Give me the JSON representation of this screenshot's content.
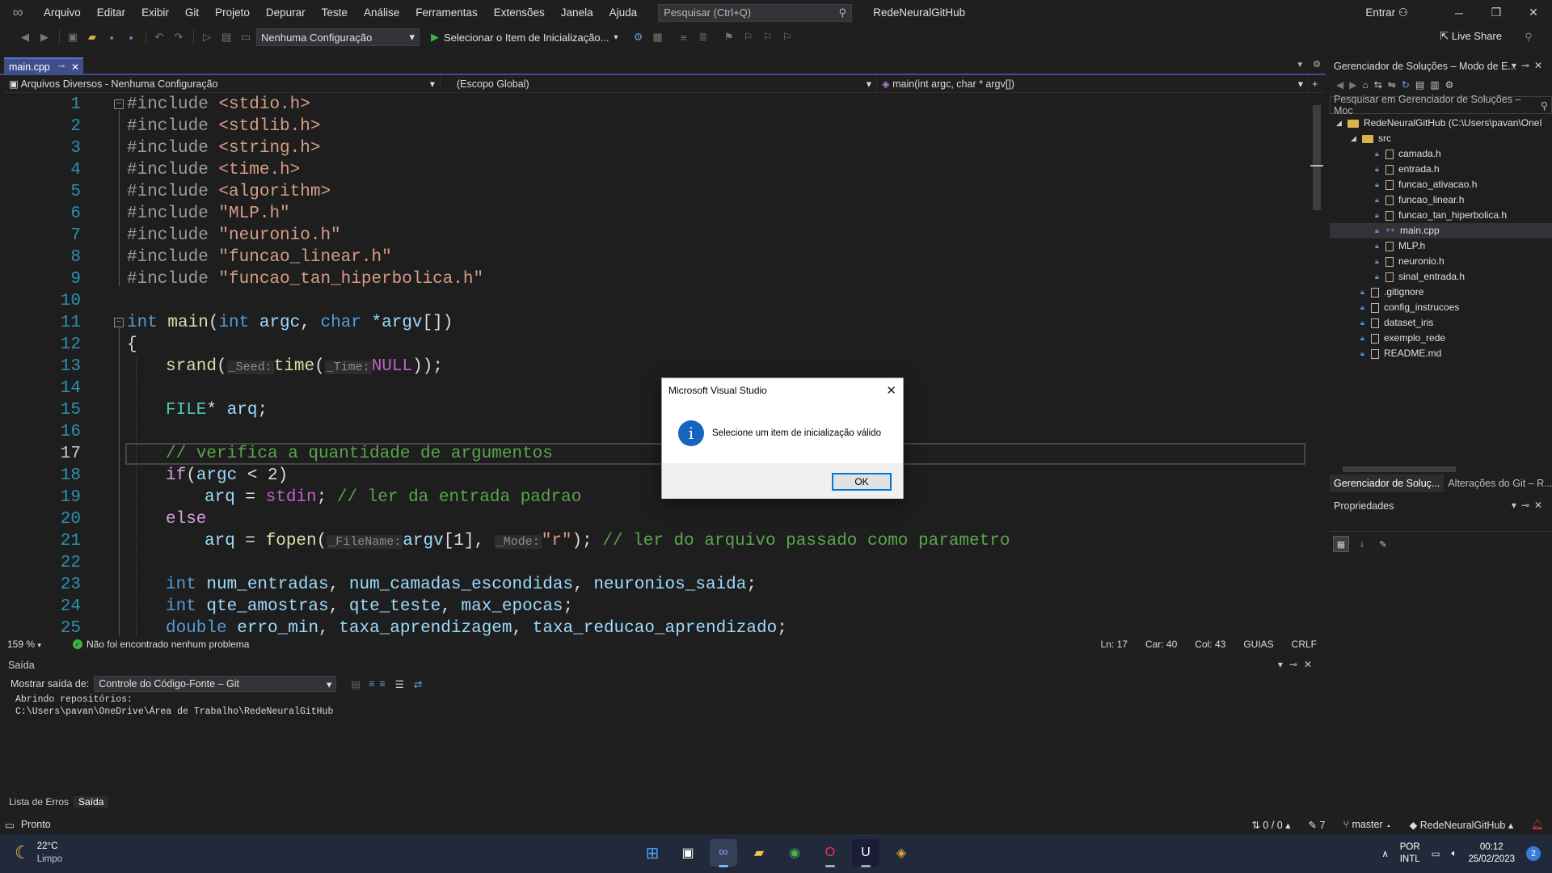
{
  "menu": {
    "items": [
      "Arquivo",
      "Editar",
      "Exibir",
      "Git",
      "Projeto",
      "Depurar",
      "Teste",
      "Análise",
      "Ferramentas",
      "Extensões",
      "Janela",
      "Ajuda"
    ],
    "search_placeholder": "Pesquisar (Ctrl+Q)",
    "solution_name": "RedeNeuralGitHub",
    "signin": "Entrar"
  },
  "toolbar": {
    "config": "Nenhuma Configuração",
    "run_label": "Selecionar o Item de Inicialização...",
    "live_share": "Live Share"
  },
  "editor": {
    "tab_name": "main.cpp",
    "nav_project": "Arquivos Diversos - Nenhuma Configuração",
    "nav_scope": "(Escopo Global)",
    "nav_member": "main(int argc, char * argv[])",
    "line_numbers": [
      "1",
      "2",
      "3",
      "4",
      "5",
      "6",
      "7",
      "8",
      "9",
      "10",
      "11",
      "12",
      "13",
      "14",
      "15",
      "16",
      "17",
      "18",
      "19",
      "20",
      "21",
      "22",
      "23",
      "24",
      "25"
    ],
    "lines": {
      "l1_pp": "#include",
      "l1_rest": " <stdio.h>",
      "l2_pp": "#include",
      "l2_rest": " <stdlib.h>",
      "l3_pp": "#include",
      "l3_rest": " <string.h>",
      "l4_pp": "#include",
      "l4_rest": " <time.h>",
      "l5_pp": "#include",
      "l5_rest": " <algorithm>",
      "l6_pp": "#include",
      "l6_rest": " \"MLP.h\"",
      "l7_pp": "#include",
      "l7_rest": " \"neuronio.h\"",
      "l8_pp": "#include",
      "l8_rest": " \"funcao_linear.h\"",
      "l9_pp": "#include",
      "l9_rest": " \"funcao_tan_hiperbolica.h\"",
      "l11_int": "int",
      "l11_main": " main",
      "l11_p1": "(",
      "l11_int2": "int",
      "l11_argc": " argc",
      "l11_c": ", ",
      "l11_char": "char",
      "l11_argv": " *argv",
      "l11_end": "[])",
      "l12": "{",
      "l13_srand": "srand",
      "l13_p": "(",
      "l13_hint1": "_Seed:",
      "l13_time": "time",
      "l13_p2": "(",
      "l13_hint2": "_Time:",
      "l13_null": "NULL",
      "l13_end": "));",
      "l15_type": "FILE",
      "l15_rest": "* ",
      "l15_var": "arq",
      "l15_end": ";",
      "l17": "// verifica a quantidade de argumentos",
      "l18_if": "if",
      "l18_p": "(",
      "l18_argc": "argc",
      "l18_rest": " < 2)",
      "l19_arq": "arq",
      "l19_eq": " = ",
      "l19_stdin": "stdin",
      "l19_semi": "; ",
      "l19_cmt": "// ler da entrada padrao",
      "l20": "else",
      "l21_arq": "arq",
      "l21_eq": " = ",
      "l21_fopen": "fopen",
      "l21_p": "(",
      "l21_hint1": "_FileName:",
      "l21_argv": "argv",
      "l21_idx": "[1], ",
      "l21_hint2": "_Mode:",
      "l21_str": "\"r\"",
      "l21_semi": "); ",
      "l21_cmt": "// ler do arquivo passado como parametro",
      "l23_int": "int",
      "l23_vars": " num_entradas",
      "l23_c1": ", ",
      "l23_v2": "num_camadas_escondidas",
      "l23_c2": ", ",
      "l23_v3": "neuronios_saida",
      "l23_end": ";",
      "l24_int": "int",
      "l24_v1": " qte_amostras",
      "l24_c1": ", ",
      "l24_v2": "qte_teste",
      "l24_c2": ", ",
      "l24_v3": "max_epocas",
      "l24_end": ";",
      "l25_dbl": "double",
      "l25_v1": " erro_min",
      "l25_c1": ", ",
      "l25_v2": "taxa_aprendizagem",
      "l25_c2": ", ",
      "l25_v3": "taxa_reducao_aprendizado",
      "l25_end": ";"
    },
    "zoom": "159 %",
    "issues": "Não foi encontrado nenhum problema",
    "ln": "Ln: 17",
    "car": "Car: 40",
    "col": "Col: 43",
    "guides": "GUIAS",
    "eol": "CRLF"
  },
  "output": {
    "title": "Saída",
    "show_from_label": "Mostrar saída de:",
    "source": "Controle do Código-Fonte – Git",
    "text_line1": "Abrindo repositórios:",
    "text_line2": "C:\\Users\\pavan\\OneDrive\\Área de Trabalho\\RedeNeuralGitHub",
    "tabs": [
      "Lista de Erros",
      "Saída"
    ]
  },
  "solution_explorer": {
    "title": "Gerenciador de Soluções – Modo de E...",
    "search_placeholder": "Pesquisar em Gerenciador de Soluções – Moc",
    "root": "RedeNeuralGitHub (C:\\Users\\pavan\\OneI",
    "folder": "src",
    "src_files": [
      "camada.h",
      "entrada.h",
      "funcao_ativacao.h",
      "funcao_linear.h",
      "funcao_tan_hiperbolica.h",
      "main.cpp",
      "MLP.h",
      "neuronio.h",
      "sinal_entrada.h"
    ],
    "root_files": [
      ".gitignore",
      "config_instrucoes",
      "dataset_iris",
      "exemplo_rede",
      "README.md"
    ],
    "tabs": [
      "Gerenciador de Soluç...",
      "Alterações do Git – R..."
    ]
  },
  "properties": {
    "title": "Propriedades"
  },
  "statusbar": {
    "ready": "Pronto",
    "commits": "0 / 0",
    "changes": "7",
    "branch": "master",
    "repo": "RedeNeuralGitHub"
  },
  "dialog": {
    "title": "Microsoft Visual Studio",
    "message": "Selecione um item de inicialização válido",
    "ok": "OK"
  },
  "taskbar": {
    "temp": "22°C",
    "weather": "Limpo",
    "lang1": "POR",
    "lang2": "INTL",
    "time": "00:12",
    "date": "25/02/2023",
    "notifications": "2"
  }
}
